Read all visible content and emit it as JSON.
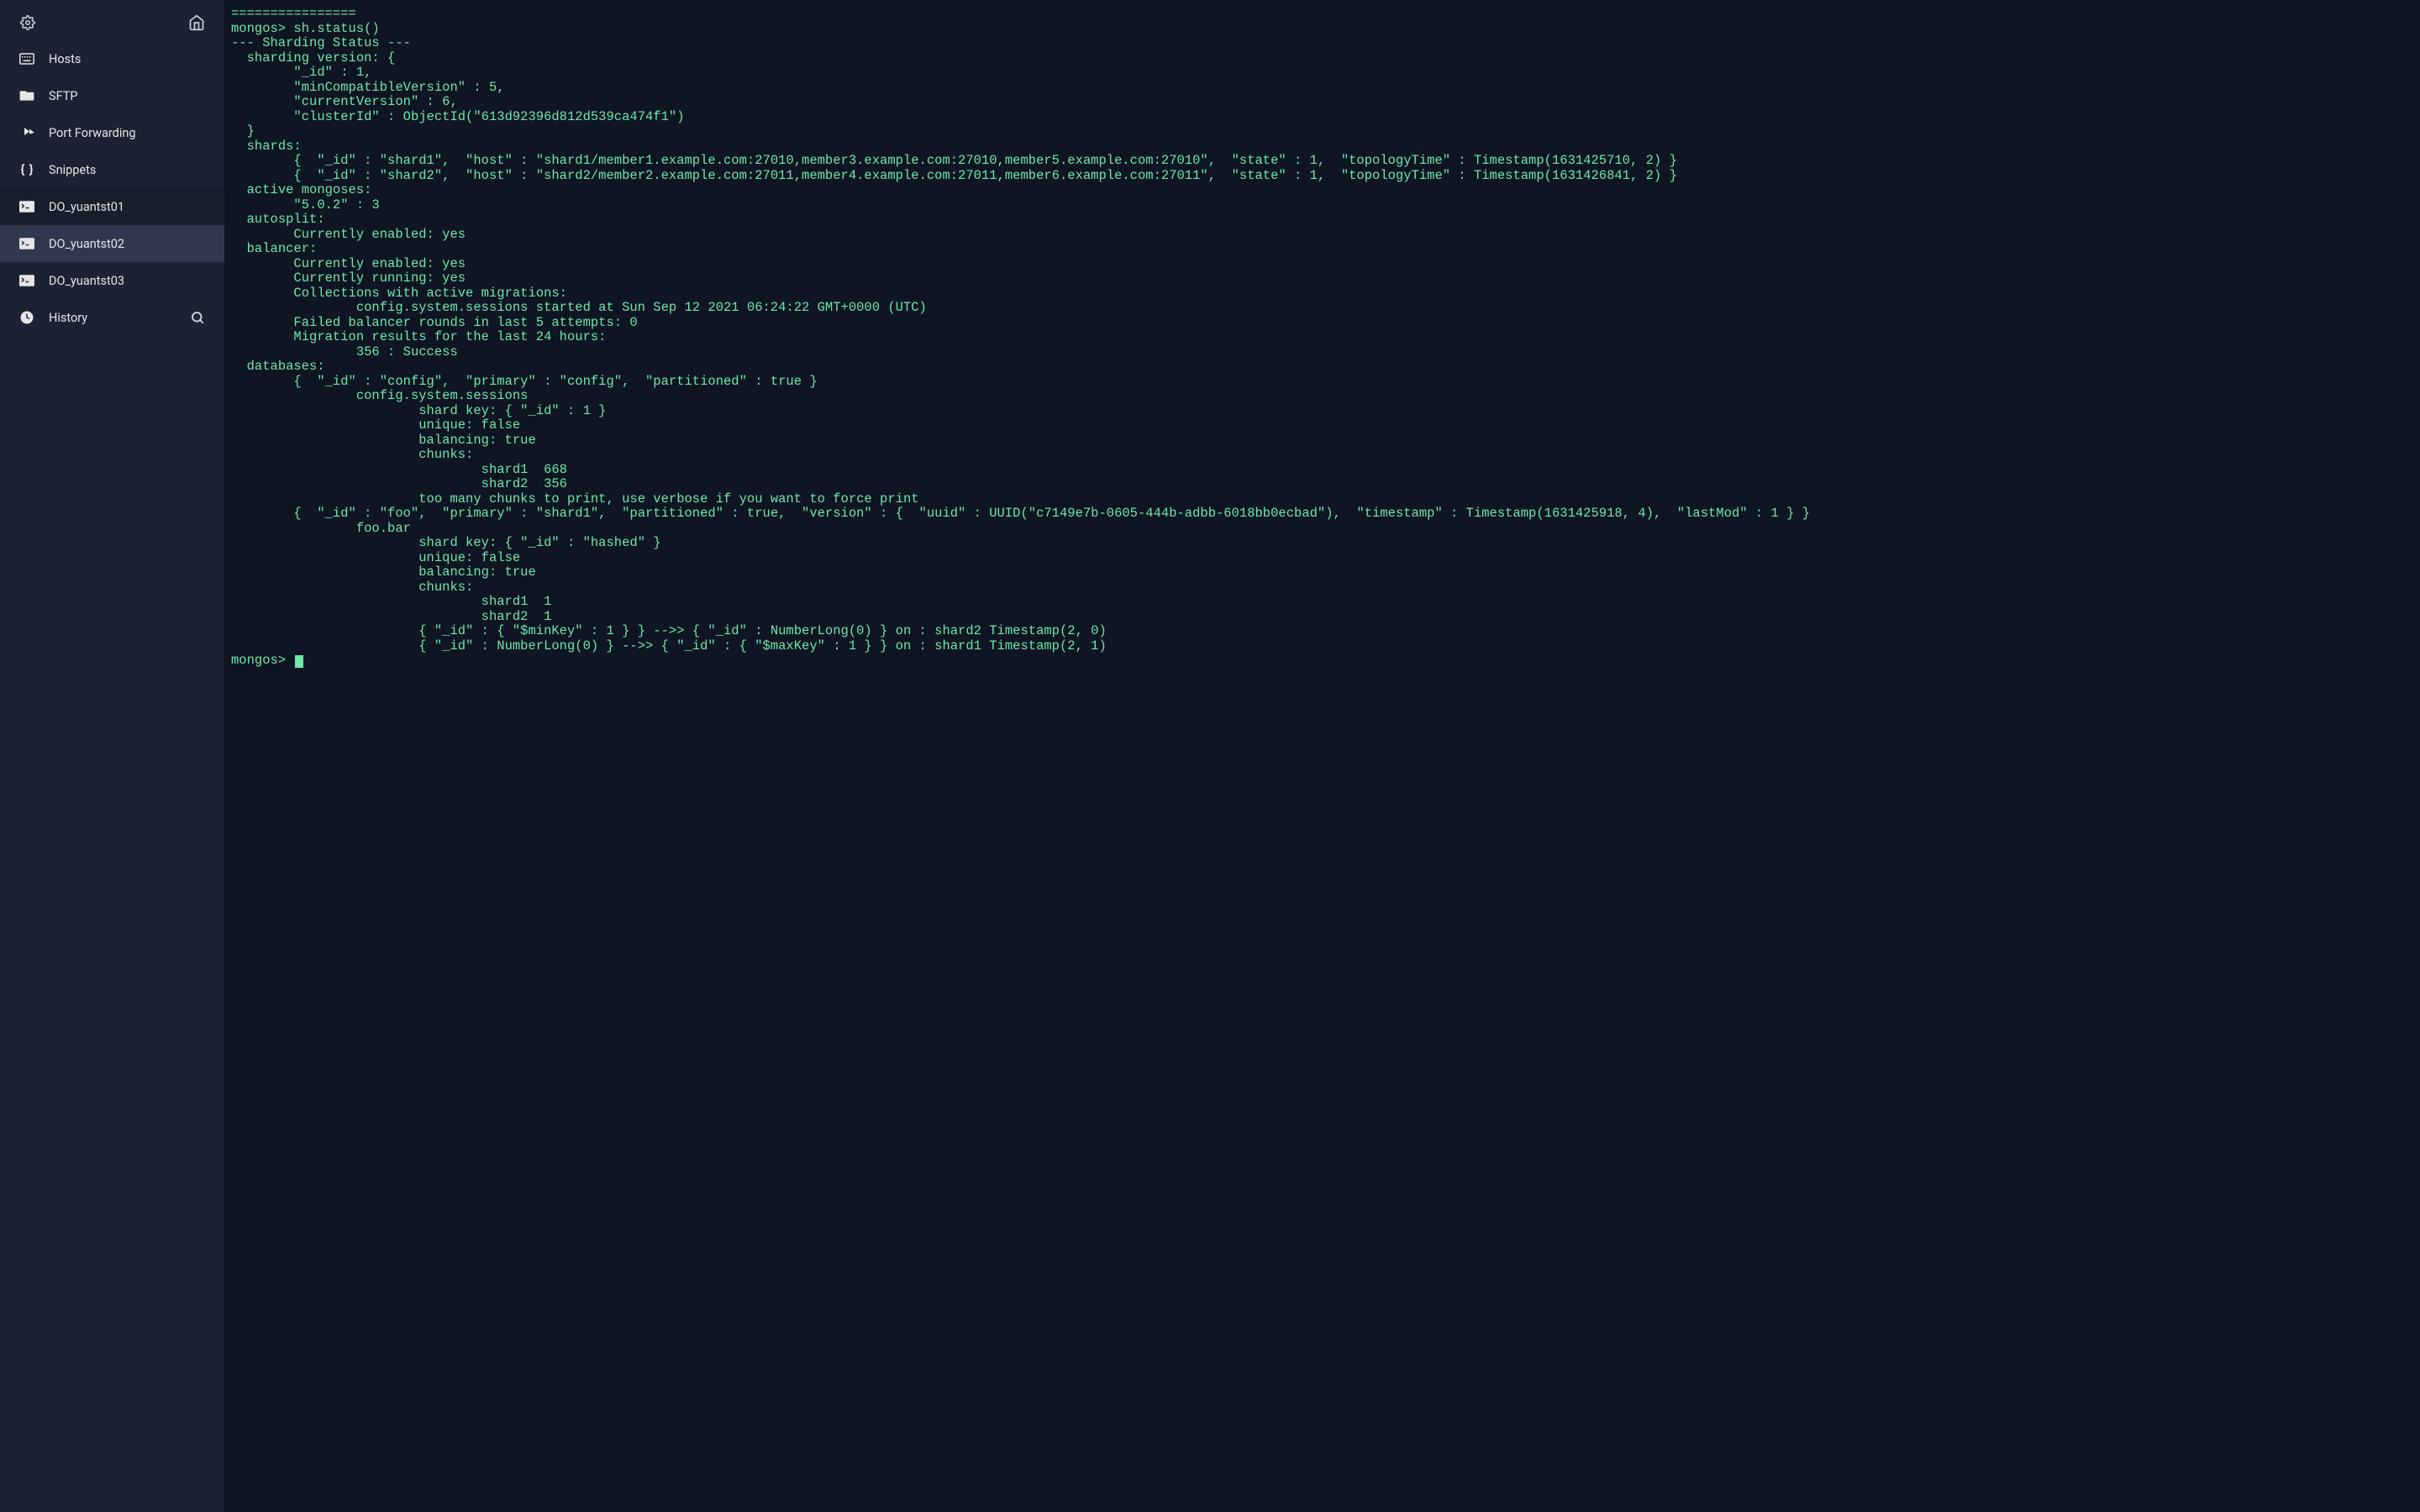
{
  "sidebar": {
    "items": [
      {
        "label": "Hosts"
      },
      {
        "label": "SFTP"
      },
      {
        "label": "Port Forwarding"
      },
      {
        "label": "Snippets"
      },
      {
        "label": "DO_yuantst01"
      },
      {
        "label": "DO_yuantst02"
      },
      {
        "label": "DO_yuantst03"
      },
      {
        "label": "History"
      }
    ]
  },
  "terminal": {
    "output": "================\nmongos> sh.status()\n--- Sharding Status ---\n  sharding version: {\n        \"_id\" : 1,\n        \"minCompatibleVersion\" : 5,\n        \"currentVersion\" : 6,\n        \"clusterId\" : ObjectId(\"613d92396d812d539ca474f1\")\n  }\n  shards:\n        {  \"_id\" : \"shard1\",  \"host\" : \"shard1/member1.example.com:27010,member3.example.com:27010,member5.example.com:27010\",  \"state\" : 1,  \"topologyTime\" : Timestamp(1631425710, 2) }\n        {  \"_id\" : \"shard2\",  \"host\" : \"shard2/member2.example.com:27011,member4.example.com:27011,member6.example.com:27011\",  \"state\" : 1,  \"topologyTime\" : Timestamp(1631426841, 2) }\n  active mongoses:\n        \"5.0.2\" : 3\n  autosplit:\n        Currently enabled: yes\n  balancer:\n        Currently enabled: yes\n        Currently running: yes\n        Collections with active migrations:\n                config.system.sessions started at Sun Sep 12 2021 06:24:22 GMT+0000 (UTC)\n        Failed balancer rounds in last 5 attempts: 0\n        Migration results for the last 24 hours:\n                356 : Success\n  databases:\n        {  \"_id\" : \"config\",  \"primary\" : \"config\",  \"partitioned\" : true }\n                config.system.sessions\n                        shard key: { \"_id\" : 1 }\n                        unique: false\n                        balancing: true\n                        chunks:\n                                shard1  668\n                                shard2  356\n                        too many chunks to print, use verbose if you want to force print\n        {  \"_id\" : \"foo\",  \"primary\" : \"shard1\",  \"partitioned\" : true,  \"version\" : {  \"uuid\" : UUID(\"c7149e7b-0605-444b-adbb-6018bb0ecbad\"),  \"timestamp\" : Timestamp(1631425918, 4),  \"lastMod\" : 1 } }\n                foo.bar\n                        shard key: { \"_id\" : \"hashed\" }\n                        unique: false\n                        balancing: true\n                        chunks:\n                                shard1  1\n                                shard2  1\n                        { \"_id\" : { \"$minKey\" : 1 } } -->> { \"_id\" : NumberLong(0) } on : shard2 Timestamp(2, 0)\n                        { \"_id\" : NumberLong(0) } -->> { \"_id\" : { \"$maxKey\" : 1 } } on : shard1 Timestamp(2, 1)\nmongos> "
  },
  "colors": {
    "sidebar_bg": "#1d2233",
    "terminal_bg": "#0f1523",
    "terminal_fg": "#6ee7a8",
    "active_bg": "#30384f"
  }
}
